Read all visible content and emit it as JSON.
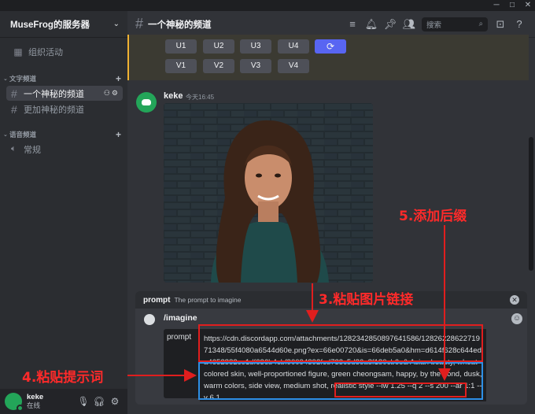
{
  "server": {
    "name": "MuseFrog的服务器"
  },
  "sidebar": {
    "events_label": "组织活动",
    "text_category": "文字频道",
    "text_channels": [
      {
        "name": "一个神秘的频道",
        "active": true
      },
      {
        "name": "更加神秘的频道",
        "active": false
      }
    ],
    "voice_category": "语音频道",
    "voice_channels": [
      {
        "name": "常规"
      }
    ]
  },
  "user": {
    "name": "keke",
    "status": "在线"
  },
  "header": {
    "channel": "一个神秘的频道",
    "search_placeholder": "搜索"
  },
  "bot_buttons": {
    "upscale": [
      "U1",
      "U2",
      "U3",
      "U4"
    ],
    "variation": [
      "V1",
      "V2",
      "V3",
      "V4"
    ]
  },
  "message": {
    "author": "keke",
    "time": "今天16:45"
  },
  "command": {
    "hint_key": "prompt",
    "hint_desc": "The prompt to imagine",
    "name": "/imagine",
    "option_label": "prompt",
    "value_url": "https://cdn.discordapp.com/attachments/1282342850897641586/1282622862271971348/55f4080a6544d60e.png?ex=66e00720&is=66deb5a0&hm=d614f628c644eda4652882ce1df636b4cbf90094392fcd733c5d86a8f180cb6e&",
    "value_prompt": " Asian beauty, wheat-colored skin, well-proportioned figure, green cheongsam, happy, by the pond, dusk, warm colors, side view, medium shot, realistic style ",
    "value_suffix": "--iw 1.25 --q 2 --s 200 --ar 1:1 --v 6.1"
  },
  "annotations": {
    "step3": "3.粘贴图片链接",
    "step4": "4.粘贴提示词",
    "step5": "5.添加后缀",
    "color": "#ff2a2a"
  },
  "colors": {
    "accent": "#5865f2",
    "online": "#23a559",
    "highlight": "#f0b232",
    "annotation_box_blue": "#2d8fe6"
  }
}
